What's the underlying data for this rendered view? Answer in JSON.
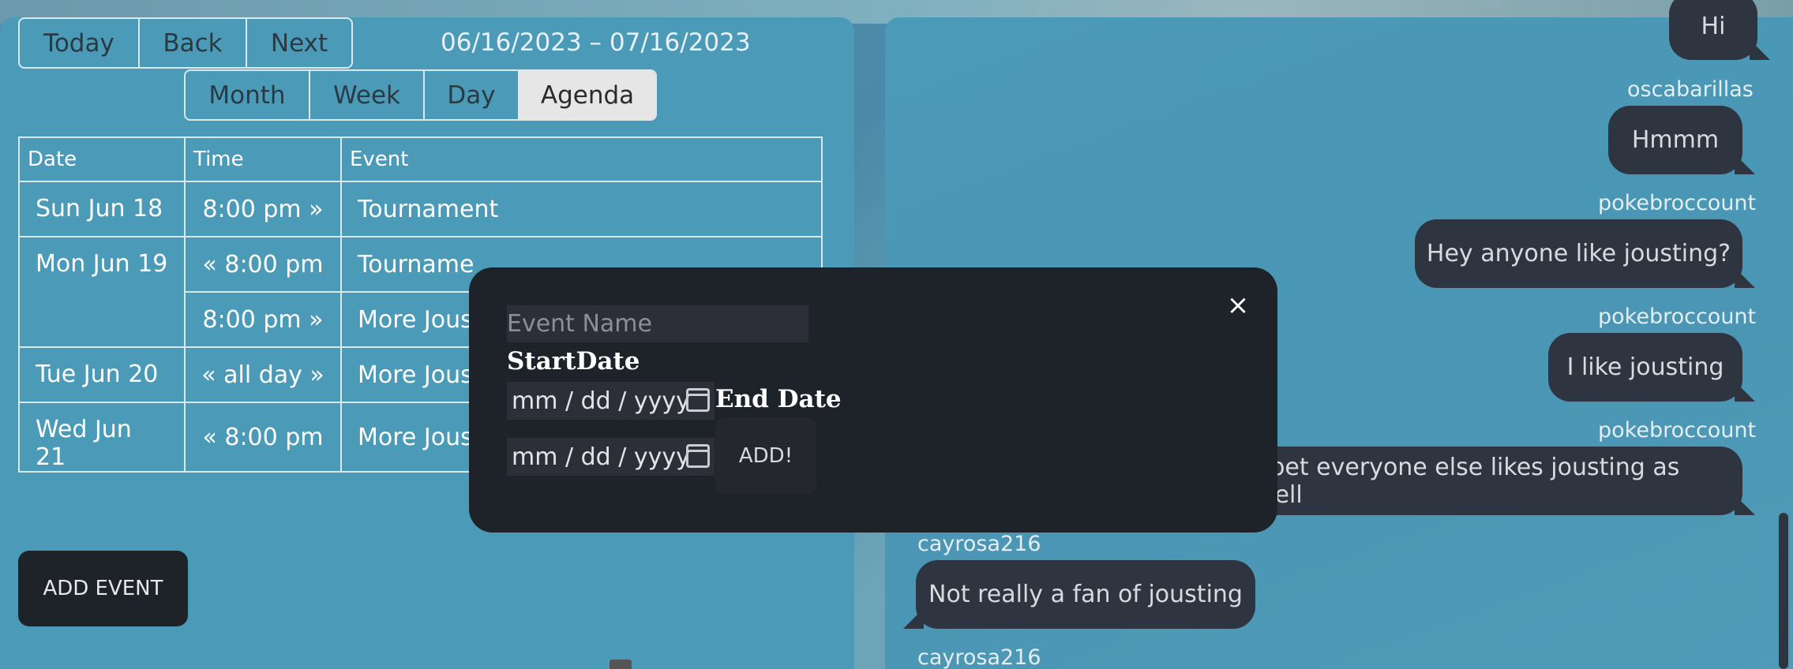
{
  "calendar": {
    "nav": [
      "Today",
      "Back",
      "Next"
    ],
    "range": "06/16/2023 – 07/16/2023",
    "views": [
      "Month",
      "Week",
      "Day",
      "Agenda"
    ],
    "active_view": "Agenda",
    "columns": [
      "Date",
      "Time",
      "Event"
    ],
    "rows": [
      {
        "date": "Sun Jun 18",
        "time": "8:00 pm »",
        "event": "Tournament"
      },
      {
        "date": "Mon Jun 19",
        "time": "« 8:00 pm",
        "event": "Tourname"
      },
      {
        "date": "",
        "time": "8:00 pm »",
        "event": "More Jous"
      },
      {
        "date": "Tue Jun 20",
        "time": "« all day »",
        "event": "More Jous"
      },
      {
        "date": "Wed Jun 21",
        "time": "« 8:00 pm",
        "event": "More Jous"
      }
    ],
    "add_event_label": "ADD EVENT"
  },
  "chat": {
    "messages": [
      {
        "user": "",
        "text": "Hi",
        "side": "right"
      },
      {
        "user": "oscabarillas",
        "text": "Hmmm",
        "side": "right"
      },
      {
        "user": "pokebroccount",
        "text": "Hey anyone like jousting?",
        "side": "right"
      },
      {
        "user": "pokebroccount",
        "text": "I like jousting",
        "side": "right"
      },
      {
        "user": "pokebroccount",
        "text": "I bet everyone else likes jousting as well",
        "side": "right"
      },
      {
        "user": "cayrosa216",
        "text": "Not really a fan of jousting",
        "side": "left"
      },
      {
        "user": "cayrosa216",
        "text": "",
        "side": "left"
      }
    ]
  },
  "modal": {
    "close": "×",
    "event_name_placeholder": "Event Name",
    "start_label": "StartDate",
    "end_label": "End Date",
    "date_placeholder": "mm / dd / yyyy",
    "add_label": "ADD!"
  },
  "colors": {
    "panel": "#4b9ab8",
    "modal": "#1e2229",
    "bubble": "#2e3540"
  }
}
